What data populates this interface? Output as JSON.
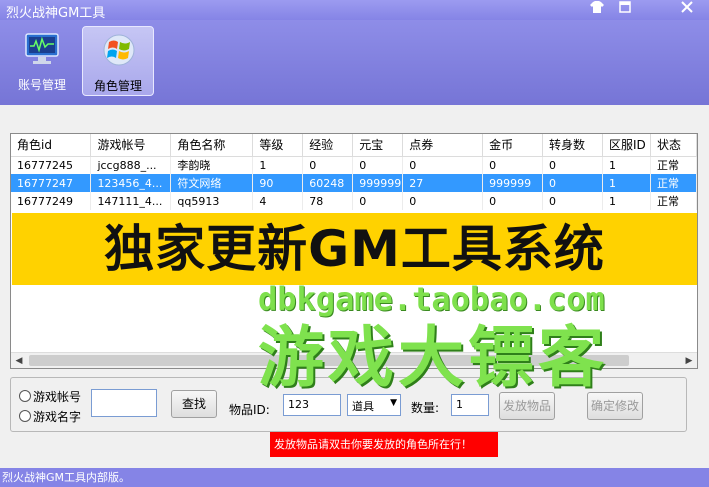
{
  "window": {
    "title": "烈火战神GM工具",
    "controls": [
      "shirt-icon",
      "restore-icon",
      "close-icon"
    ]
  },
  "toolbar": {
    "items": [
      {
        "label": "账号管理",
        "icon": "monitor-chart-icon",
        "active": false
      },
      {
        "label": "角色管理",
        "icon": "windows-logo-icon",
        "active": true
      }
    ]
  },
  "grid": {
    "columns": [
      "角色id",
      "游戏帐号",
      "角色名称",
      "等级",
      "经验",
      "元宝",
      "点券",
      "金币",
      "转身数",
      "区服ID",
      "状态"
    ],
    "rows": [
      {
        "cells": [
          "16777245",
          "jccg888_...",
          "李韵晓",
          "1",
          "0",
          "0",
          "0",
          "0",
          "0",
          "1",
          "正常"
        ],
        "selected": false
      },
      {
        "cells": [
          "16777247",
          "123456_4...",
          "符文网络",
          "90",
          "60248",
          "999999",
          "27",
          "999999",
          "0",
          "1",
          "正常"
        ],
        "selected": true
      },
      {
        "cells": [
          "16777249",
          "147111_4...",
          "qq5913",
          "4",
          "78",
          "0",
          "0",
          "0",
          "0",
          "1",
          "正常"
        ],
        "selected": false
      }
    ]
  },
  "search": {
    "radio_account": "游戏帐号",
    "radio_name": "游戏名字",
    "input_value": "",
    "find_label": "查找",
    "item_id_label": "物品ID:",
    "item_id_value": "123",
    "item_type_value": "道具",
    "quantity_label": "数量:",
    "quantity_value": "1",
    "send_label": "发放物品",
    "confirm_label": "确定修改"
  },
  "notice": "发放物品请双击你要发放的角色所在行！",
  "statusbar": "烈火战神GM工具内部版。",
  "watermark": {
    "banner": "独家更新GM工具系统",
    "url": "dbkgame.taobao.com",
    "name": "游戏大镖客"
  },
  "colors": {
    "titlebar": "#8584e6",
    "selection": "#3399ff",
    "banner": "#ffd200",
    "watermark_green": "#7fe24e",
    "notice": "#ff0000"
  }
}
